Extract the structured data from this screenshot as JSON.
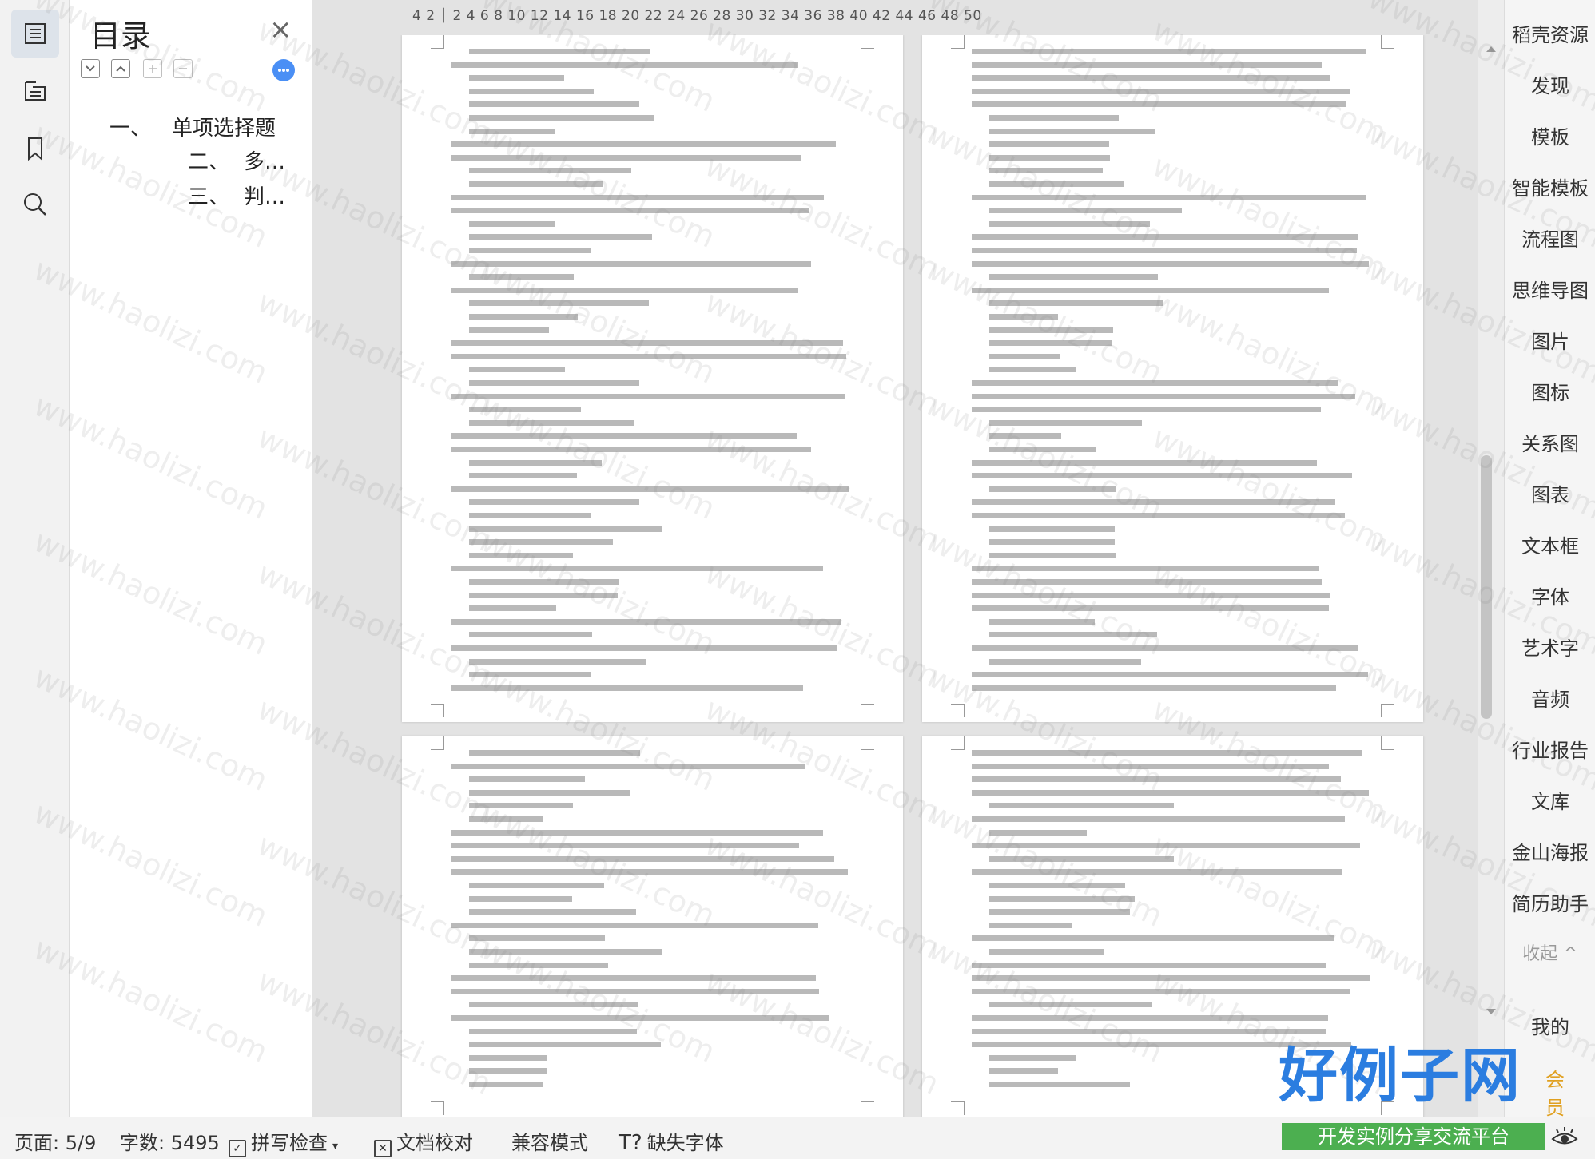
{
  "toc": {
    "title": "目录",
    "close": "×",
    "items": [
      {
        "num": "一、",
        "label": "单项选择题"
      },
      {
        "num": "二、",
        "label": "多…"
      },
      {
        "num": "三、",
        "label": "判…"
      }
    ]
  },
  "ruler": {
    "numbers": "4  2 ⏐ 2  4  6  8 10 12 14 16 18 20 22 24 26 28 30 32 34 36 38 40 42 44 46 48 50"
  },
  "right_panel": {
    "items": [
      "稻壳资源",
      "发现",
      "模板",
      "智能模板",
      "流程图",
      "思维导图",
      "图片",
      "图标",
      "关系图",
      "图表",
      "文本框",
      "字体",
      "艺术字",
      "音频",
      "行业报告",
      "文库",
      "金山海报",
      "简历助手"
    ],
    "collapse": "收起 ^",
    "mine": "我的",
    "member": "会员"
  },
  "status": {
    "page": "页面: 5/9",
    "words": "字数: 5495",
    "spell": "拼写检查",
    "proof": "文档校对",
    "compat": "兼容模式",
    "missing_font": "缺失字体"
  },
  "watermark": "www.haolizi.com",
  "logo": {
    "main": "好例子网",
    "sub": "开发实例分享交流平台"
  }
}
